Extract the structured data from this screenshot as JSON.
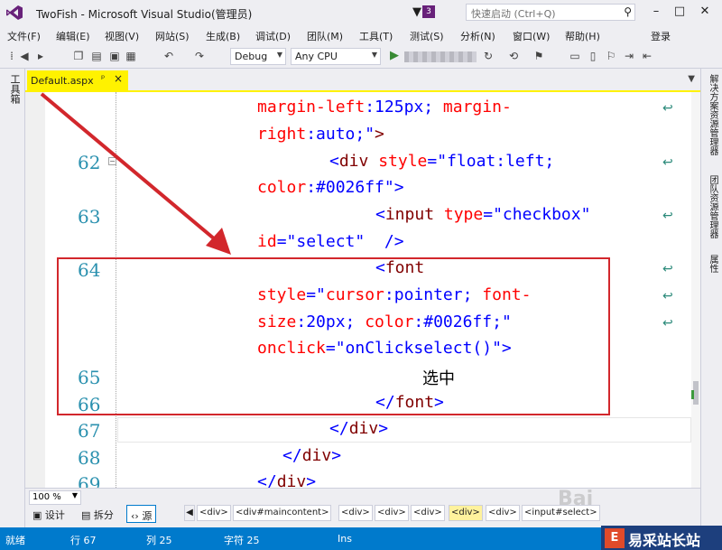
{
  "titlebar": {
    "title": "TwoFish - Microsoft Visual Studio(管理员)",
    "notification_count": "3",
    "quicklaunch_placeholder": "快速启动 (Ctrl+Q)",
    "icons": [
      "vs-logo-icon",
      "filter-icon",
      "search-icon",
      "minimize-icon",
      "maximize-icon",
      "close-icon"
    ]
  },
  "menu": {
    "items": [
      "文件(F)",
      "编辑(E)",
      "视图(V)",
      "网站(S)",
      "生成(B)",
      "调试(D)",
      "团队(M)",
      "工具(T)",
      "测试(S)",
      "分析(N)",
      "窗口(W)",
      "帮助(H)"
    ],
    "login": "登录"
  },
  "toolbar": {
    "configuration": "Debug",
    "platform": "Any CPU"
  },
  "left_strip": {
    "toolbox_label": "工具箱"
  },
  "right_strip": {
    "tabs": [
      "解决方案资源管理器",
      "团队资源管理器",
      "属性"
    ]
  },
  "document_tab": {
    "label": "Default.aspx",
    "pin_glyph": "ᵖ",
    "close_glyph": "×"
  },
  "editor": {
    "line_numbers": [
      "62",
      "63",
      "64",
      "65",
      "66",
      "67",
      "68",
      "69"
    ],
    "lines": [
      {
        "segments": [
          [
            "attr",
            "margin-left"
          ],
          [
            "val",
            ":125px; "
          ],
          [
            "attr",
            "margin-"
          ]
        ]
      },
      {
        "segments": [
          [
            "attr",
            "right"
          ],
          [
            "val",
            ":auto;\""
          ],
          [
            "tag",
            ">"
          ]
        ]
      },
      {
        "segments": [
          [
            "val",
            "<"
          ],
          [
            "tag",
            "div"
          ],
          [
            "val",
            " "
          ],
          [
            "attr",
            "style"
          ],
          [
            "val",
            "=\"float:left;"
          ]
        ]
      },
      {
        "segments": [
          [
            "attr",
            "color"
          ],
          [
            "val",
            ":#0026ff\""
          ],
          [
            "val",
            ">"
          ]
        ]
      },
      {
        "segments": [
          [
            "val",
            "<"
          ],
          [
            "tag",
            "input"
          ],
          [
            "val",
            " "
          ],
          [
            "attr",
            "type"
          ],
          [
            "val",
            "=\"checkbox\""
          ]
        ]
      },
      {
        "segments": [
          [
            "attr",
            "id"
          ],
          [
            "val",
            "=\"select\"  />"
          ]
        ]
      },
      {
        "segments": [
          [
            "val",
            "<"
          ],
          [
            "tag",
            "font"
          ]
        ]
      },
      {
        "segments": [
          [
            "attr",
            "style"
          ],
          [
            "val",
            "=\""
          ],
          [
            "attr",
            "cursor"
          ],
          [
            "val",
            ":pointer; "
          ],
          [
            "attr",
            "font-"
          ]
        ]
      },
      {
        "segments": [
          [
            "attr",
            "size"
          ],
          [
            "val",
            ":20px; "
          ],
          [
            "attr",
            "color"
          ],
          [
            "val",
            ":#0026ff;\""
          ]
        ]
      },
      {
        "segments": [
          [
            "attr",
            "onclick"
          ],
          [
            "val",
            "=\"onClickselect()\">"
          ]
        ]
      },
      {
        "segments": [
          [
            "txt",
            "选中"
          ]
        ]
      },
      {
        "segments": [
          [
            "val",
            "</"
          ],
          [
            "tag",
            "font"
          ],
          [
            "val",
            ">"
          ]
        ]
      },
      {
        "segments": [
          [
            "val",
            "</"
          ],
          [
            "tag",
            "div"
          ],
          [
            "val",
            ">"
          ]
        ]
      },
      {
        "segments": [
          [
            "val",
            "</"
          ],
          [
            "tag",
            "div"
          ],
          [
            "val",
            ">"
          ]
        ]
      },
      {
        "segments": [
          [
            "val",
            "</"
          ],
          [
            "tag",
            "div"
          ],
          [
            "val",
            ">"
          ]
        ]
      }
    ]
  },
  "bottombar": {
    "zoom": "100 %",
    "view_design": "设计",
    "view_split": "拆分",
    "view_source": "源",
    "crumbs": [
      "<div>",
      "<div#maincontent>",
      "<div>",
      "<div>",
      "<div>",
      "<div>",
      "<div>",
      "<input#select>"
    ],
    "active_crumb_index": 5
  },
  "statusbar": {
    "ready": "就绪",
    "line": "行 67",
    "col": "列 25",
    "char": "字符 25",
    "mode": "Ins"
  },
  "watermark": {
    "text": "易采站长站",
    "mark": "E",
    "ghost": "Bai"
  },
  "colors": {
    "accent": "#007acc",
    "tab_active": "#fff200",
    "annotation": "#d2272c"
  }
}
